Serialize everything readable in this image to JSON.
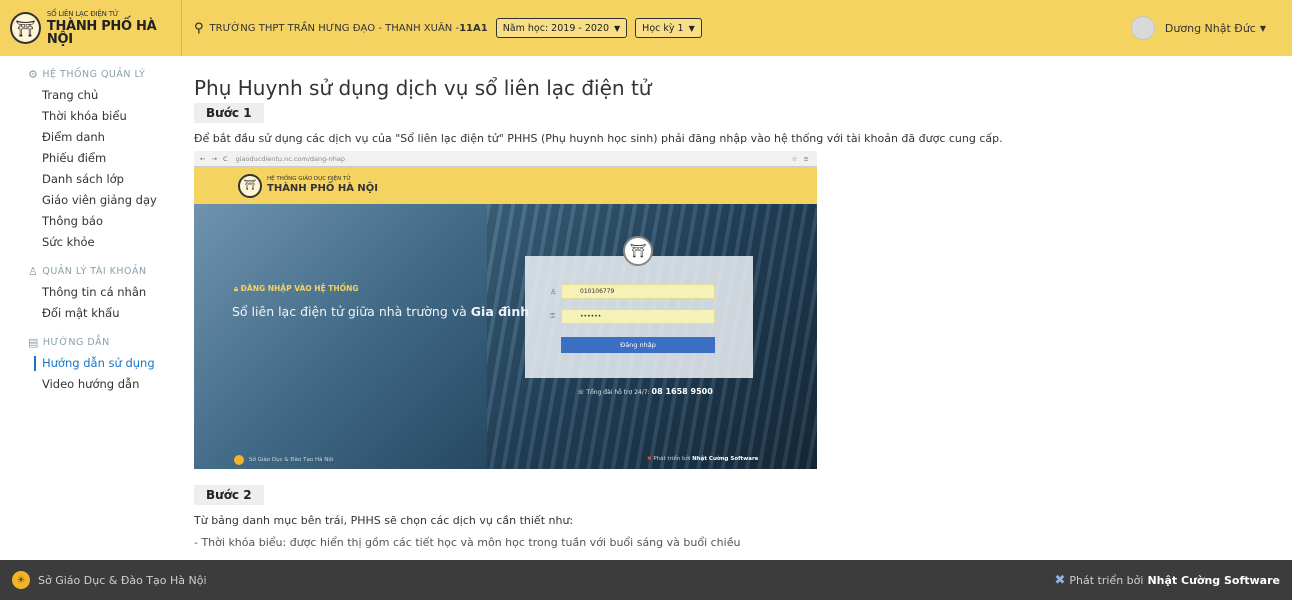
{
  "brand": {
    "small": "SỔ LIÊN LẠC ĐIỆN TỬ",
    "big": "THÀNH PHỐ HÀ NỘI"
  },
  "header": {
    "school_prefix": "TRƯỜNG THPT TRẦN HƯNG ĐẠO - THANH XUÂN - ",
    "class_name": "11A1",
    "year_select": "Năm học: 2019 - 2020",
    "term_select": "Học kỳ 1",
    "user_name": "Dương Nhật Đức"
  },
  "sidebar": {
    "sections": [
      {
        "title": "HỆ THỐNG QUẢN LÝ",
        "items": [
          "Trang chủ",
          "Thời khóa biểu",
          "Điểm danh",
          "Phiếu điểm",
          "Danh sách lớp",
          "Giáo viên giảng dạy",
          "Thông báo",
          "Sức khỏe"
        ]
      },
      {
        "title": "QUẢN LÝ TÀI KHOẢN",
        "items": [
          "Thông tin cá nhân",
          "Đổi mật khẩu"
        ]
      },
      {
        "title": "HƯỚNG DẪN",
        "items": [
          "Hướng dẫn sử dụng",
          "Video hướng dẫn"
        ]
      }
    ],
    "active_item": "Hướng dẫn sử dụng"
  },
  "main": {
    "title": "Phụ Huynh sử dụng dịch vụ sổ liên lạc điện tử",
    "step1_label": "Bước 1",
    "step1_text": "Để bắt đầu sử dụng các dịch vụ của \"Sổ liên lạc điện tử\" PHHS (Phụ huynh học sinh) phải đăng nhập vào hệ thống với tài khoản đã được cung cấp.",
    "step2_label": "Bước 2",
    "step2_text": "Từ bảng danh mục bên trái, PHHS sẽ chọn các dịch vụ cần thiết như:",
    "step2_cut": "- Thời khóa biểu: được hiển thị gồm các tiết học và môn học trong tuần với buổi sáng và buổi chiều"
  },
  "screenshot": {
    "nav": "← → C",
    "url": "giaoducdientu.nc.com/dang-nhap",
    "brand_small": "HỆ THỐNG GIÁO DỤC ĐIỆN TỬ",
    "brand_big": "THÀNH PHỐ HÀ NỘI",
    "login_label": "ĐĂNG NHẬP VÀO HỆ THỐNG",
    "tagline_prefix": "Sổ liên lạc điện tử giữa nhà trường và ",
    "tagline_bold": "Gia đình",
    "username": "010106779",
    "password": "••••••",
    "login_button": "Đăng nhập",
    "hotline_label": "Tổng đài hỗ trợ 24/7: ",
    "hotline_number": "08 1658 9500",
    "footer_left": "Sở Giáo Dục & Đào Tạo Hà Nội",
    "footer_right_prefix": "Phát triển bởi ",
    "footer_right_bold": "Nhật Cường Software"
  },
  "footer": {
    "left": "Sở Giáo Dục & Đào Tạo Hà Nội",
    "right_prefix": "Phát triển bởi",
    "right_bold": "Nhật Cường Software"
  }
}
